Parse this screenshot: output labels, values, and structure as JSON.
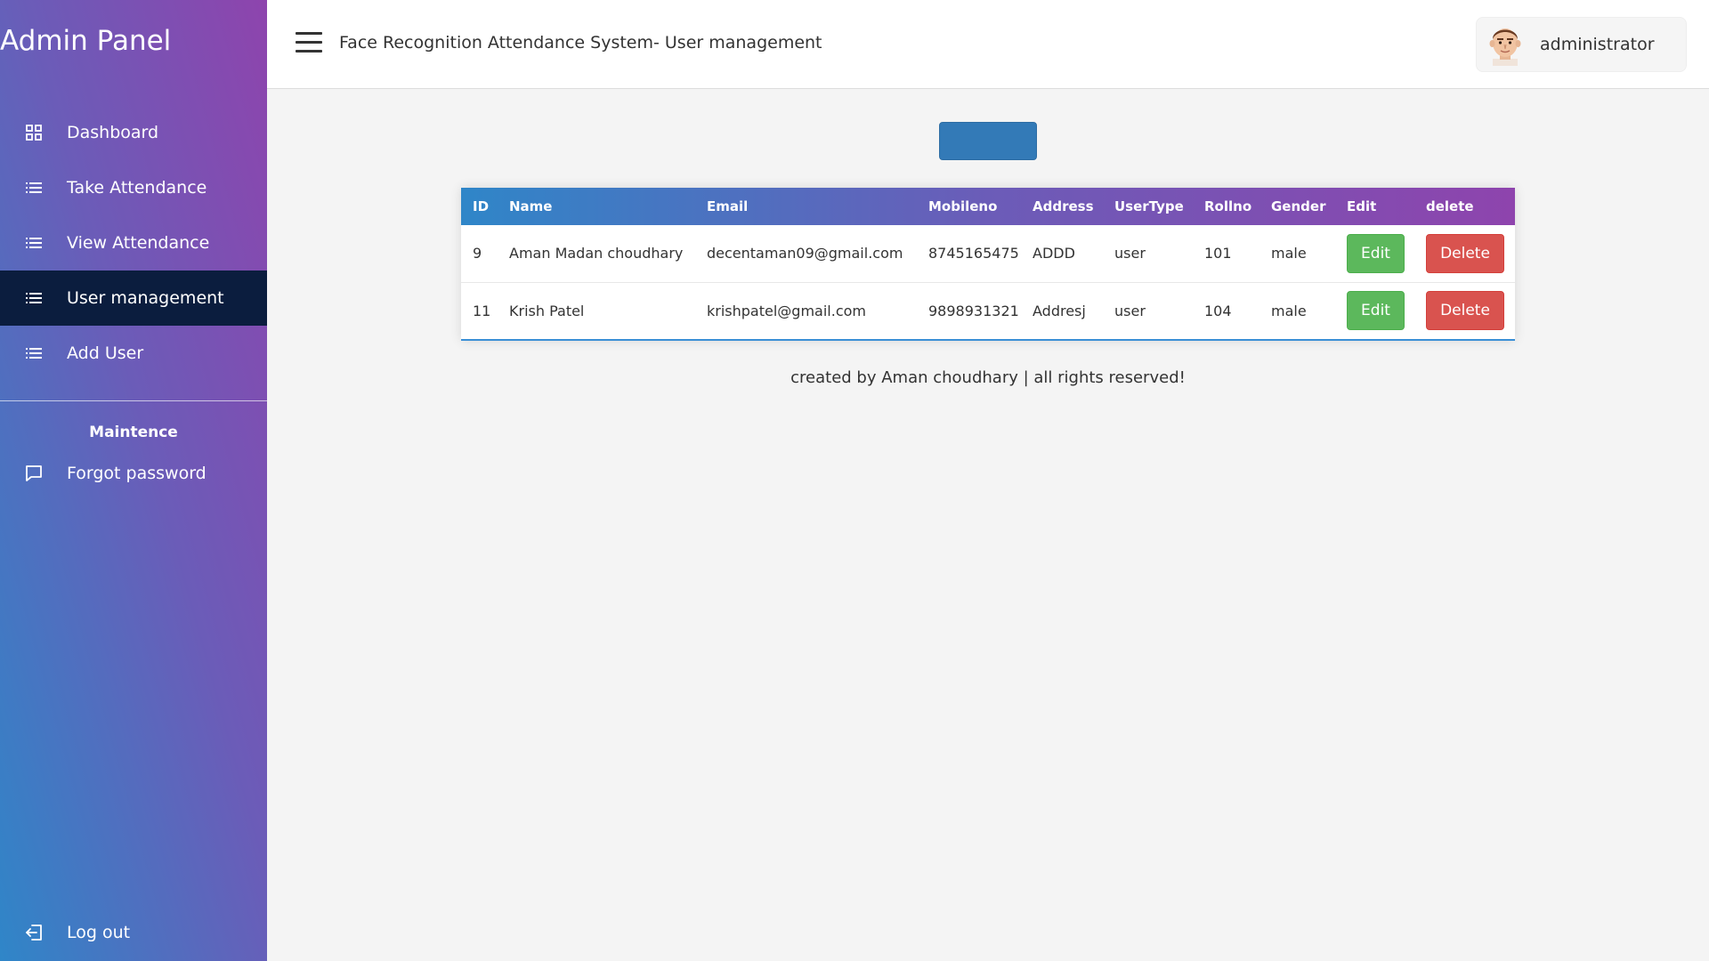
{
  "sidebar": {
    "brand": "Admin Panel",
    "items": [
      {
        "label": "Dashboard",
        "icon": "grid-icon",
        "active": false
      },
      {
        "label": "Take Attendance",
        "icon": "list-icon",
        "active": false
      },
      {
        "label": "View Attendance",
        "icon": "list-icon",
        "active": false
      },
      {
        "label": "User management",
        "icon": "list-icon",
        "active": true
      },
      {
        "label": "Add User",
        "icon": "list-icon",
        "active": false
      }
    ],
    "section_title": "Maintence",
    "forgot_label": "Forgot password",
    "logout_label": "Log out",
    "active_bg": "#0b1d3e"
  },
  "header": {
    "title": "Face Recognition Attendance System- User management",
    "user_name": "administrator"
  },
  "table": {
    "columns": [
      "ID",
      "Name",
      "Email",
      "Mobileno",
      "Address",
      "UserType",
      "Rollno",
      "Gender",
      "Edit",
      "delete"
    ],
    "rows": [
      {
        "id": "9",
        "name": "Aman Madan choudhary",
        "email": "decentaman09@gmail.com",
        "mobile": "8745165475",
        "address": "ADDD",
        "usertype": "user",
        "rollno": "101",
        "gender": "male",
        "edit": "Edit",
        "delete": "Delete"
      },
      {
        "id": "11",
        "name": "Krish Patel",
        "email": "krishpatel@gmail.com",
        "mobile": "9898931321",
        "address": "Addresj",
        "usertype": "user",
        "rollno": "104",
        "gender": "male",
        "edit": "Edit",
        "delete": "Delete"
      }
    ]
  },
  "footer": "created by Aman choudhary | all rights reserved!",
  "colors": {
    "primary_button": "#337ab7",
    "edit_button": "#5cb85c",
    "delete_button": "#d9534f"
  }
}
